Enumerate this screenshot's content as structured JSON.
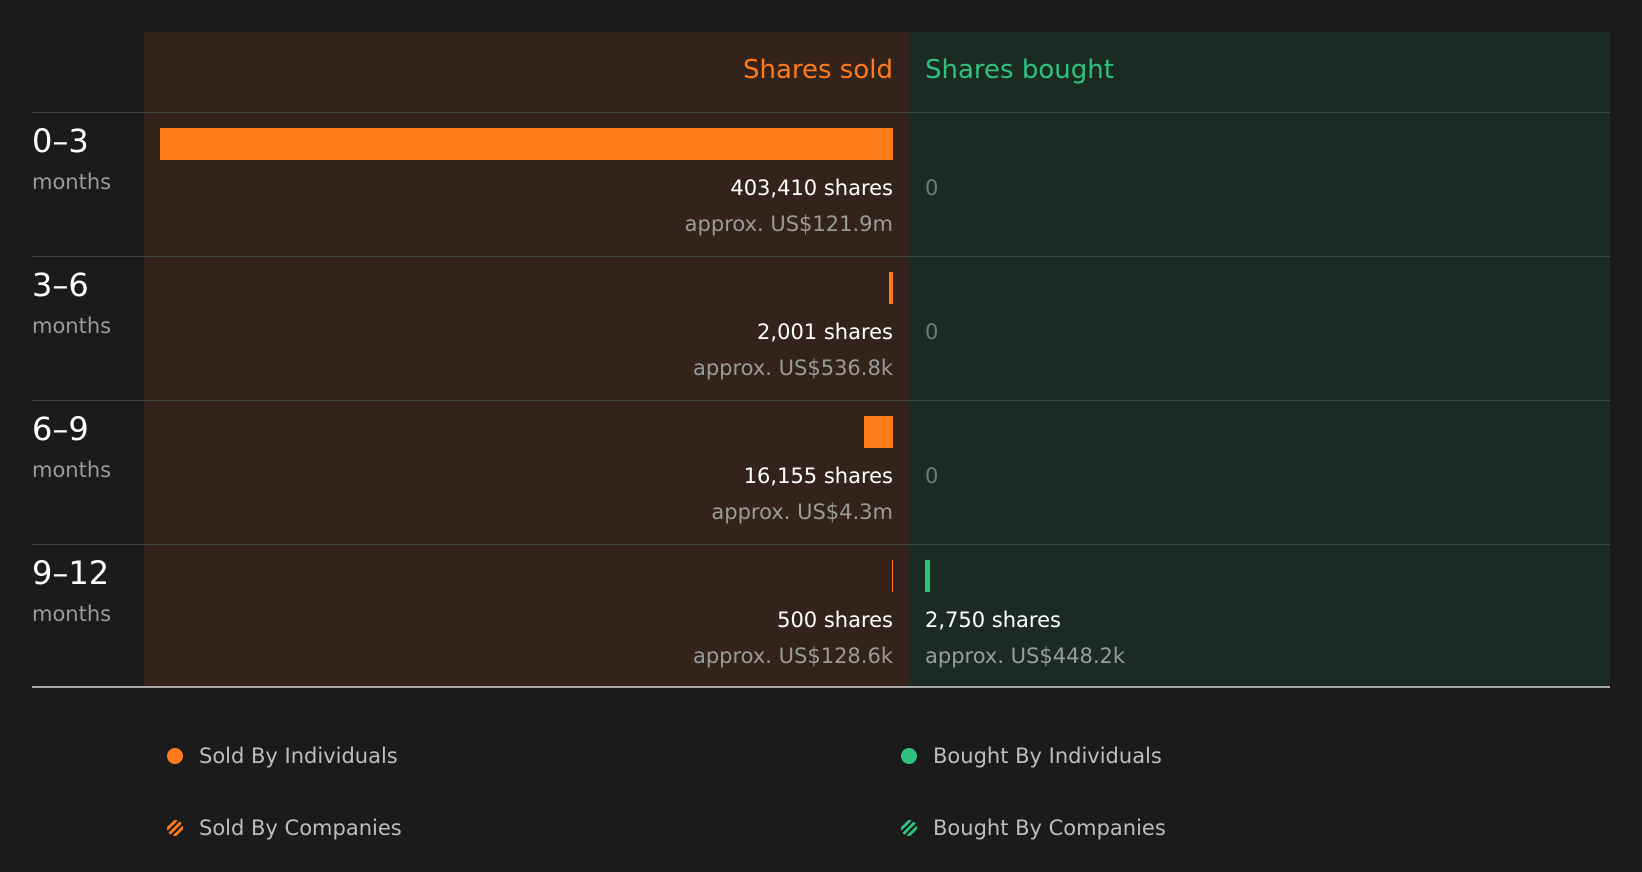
{
  "header": {
    "sold_title": "Shares sold",
    "bought_title": "Shares bought"
  },
  "colors": {
    "sold": "#ff7a1a",
    "bought": "#2ec27e",
    "sold_panel": "#33231b",
    "bought_panel": "#1b2b24"
  },
  "chart_data": {
    "type": "bar",
    "orientation": "horizontal-diverging",
    "categories": [
      "0–3",
      "3–6",
      "6–9",
      "9–12"
    ],
    "category_unit": "months",
    "series": [
      {
        "name": "Shares sold",
        "values": [
          403410,
          2001,
          16155,
          500
        ],
        "color": "#ff7a1a"
      },
      {
        "name": "Shares bought",
        "values": [
          0,
          0,
          0,
          2750
        ],
        "color": "#2ec27e"
      }
    ],
    "rows": [
      {
        "period": "0–3",
        "unit": "months",
        "sold_shares": "403,410 shares",
        "sold_value": "approx. US$121.9m",
        "bought_shares": "0",
        "bought_value": ""
      },
      {
        "period": "3–6",
        "unit": "months",
        "sold_shares": "2,001 shares",
        "sold_value": "approx. US$536.8k",
        "bought_shares": "0",
        "bought_value": ""
      },
      {
        "period": "6–9",
        "unit": "months",
        "sold_shares": "16,155 shares",
        "sold_value": "approx. US$4.3m",
        "bought_shares": "0",
        "bought_value": ""
      },
      {
        "period": "9–12",
        "unit": "months",
        "sold_shares": "500 shares",
        "sold_value": "approx. US$128.6k",
        "bought_shares": "2,750 shares",
        "bought_value": "approx. US$448.2k"
      }
    ],
    "legend": [
      {
        "label": "Sold By Individuals",
        "marker": "solid-dot",
        "color": "#ff7a1a"
      },
      {
        "label": "Bought By Individuals",
        "marker": "solid-dot",
        "color": "#2ec27e"
      },
      {
        "label": "Sold By Companies",
        "marker": "hatched-dot",
        "color": "#ff7a1a"
      },
      {
        "label": "Bought By Companies",
        "marker": "hatched-dot",
        "color": "#2ec27e"
      }
    ]
  }
}
